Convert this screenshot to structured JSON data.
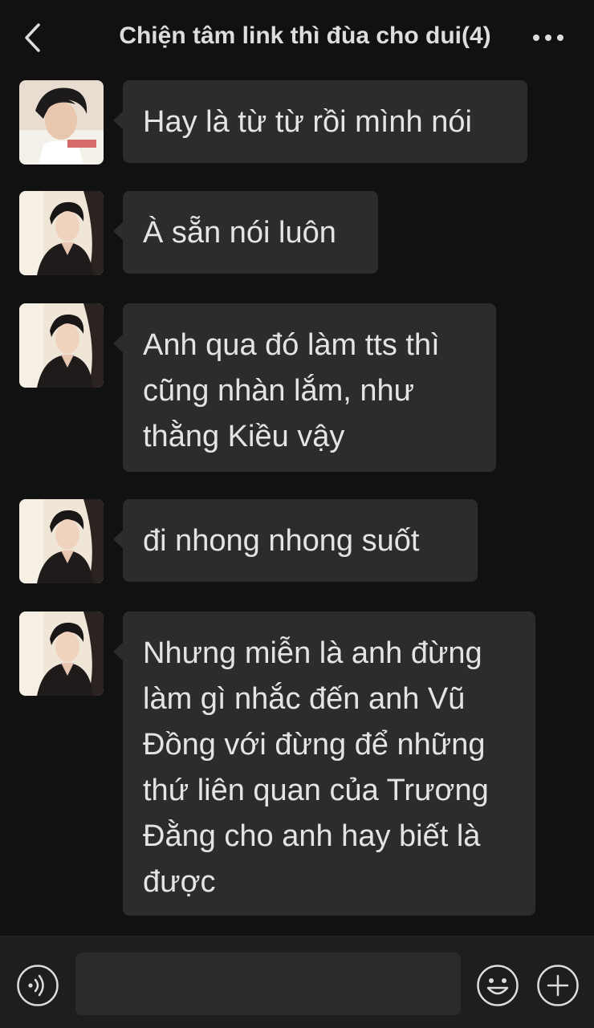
{
  "header": {
    "title": "Chiện tâm link thì đùa cho dui(4)",
    "back_icon": "chevron-left-icon",
    "more_icon": "more-dots-icon"
  },
  "messages": [
    {
      "sender": "contact-a",
      "text": "Hay là từ từ rồi mình nói"
    },
    {
      "sender": "contact-b",
      "text": "À sẵn nói luôn"
    },
    {
      "sender": "contact-b",
      "lines": [
        "Anh qua đó làm tts thì",
        "cũng nhàn lắm, như",
        "thằng Kiều vậy"
      ]
    },
    {
      "sender": "contact-b",
      "text": "đi nhong nhong suốt"
    },
    {
      "sender": "contact-b",
      "lines": [
        "Nhưng miễn là anh đừng",
        "làm gì nhắc đến anh Vũ",
        "Đồng với đừng để những",
        "thứ liên quan của Trương",
        "Đằng cho anh hay biết là",
        "được"
      ]
    }
  ],
  "input_bar": {
    "voice_icon": "voice-icon",
    "input_value": "",
    "emoji_icon": "emoji-icon",
    "plus_icon": "plus-icon"
  },
  "colors": {
    "background": "#111111",
    "bubble": "#2c2c2c",
    "text": "#e4e4e4",
    "input_bar": "#1e1e1e"
  }
}
